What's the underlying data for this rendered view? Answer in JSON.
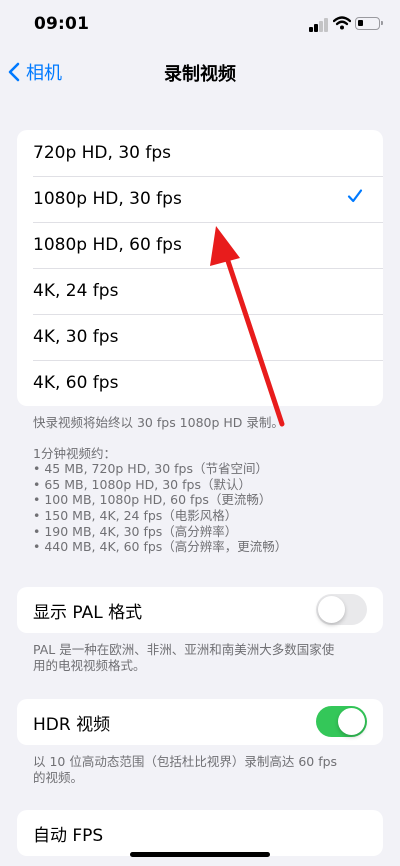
{
  "status_bar": {
    "time": "09:01"
  },
  "nav": {
    "back_label": "相机",
    "title": "录制视频"
  },
  "resolutions": {
    "options": [
      "720p HD, 30 fps",
      "1080p HD, 30 fps",
      "1080p HD, 60 fps",
      "4K, 24 fps",
      "4K, 30 fps",
      "4K, 60 fps"
    ],
    "selected": "1080p HD, 30 fps"
  },
  "resolution_footer": {
    "quick_note": "快录视频将始终以 30 fps 1080p HD 录制。",
    "size_heading": "1分钟视频约：",
    "sizes": [
      "• 45 MB, 720p HD, 30 fps（节省空间）",
      "• 65 MB, 1080p HD, 30 fps（默认）",
      "• 100 MB, 1080p HD, 60 fps（更流畅）",
      "• 150 MB, 4K, 24 fps（电影风格）",
      "• 190 MB, 4K, 30 fps（高分辨率）",
      "• 440 MB, 4K, 60 fps（高分辨率，更流畅）"
    ]
  },
  "pal": {
    "label": "显示 PAL 格式",
    "enabled": false,
    "footer_lines": [
      "PAL 是一种在欧洲、非洲、亚洲和南美洲大多数国家使",
      "用的电视视频格式。"
    ]
  },
  "hdr": {
    "label": "HDR 视频",
    "enabled": true,
    "footer_lines": [
      "以 10 位高动态范围（包括杜比视界）录制高达 60 fps",
      "的视频。"
    ]
  },
  "auto_fps": {
    "label": "自动 FPS"
  },
  "colors": {
    "accent": "#007aff",
    "toggle_on": "#34c759",
    "annotation_arrow": "#e81c1c"
  },
  "annotation": {
    "type": "red-arrow",
    "points_to": "1080p HD, 30 fps"
  }
}
